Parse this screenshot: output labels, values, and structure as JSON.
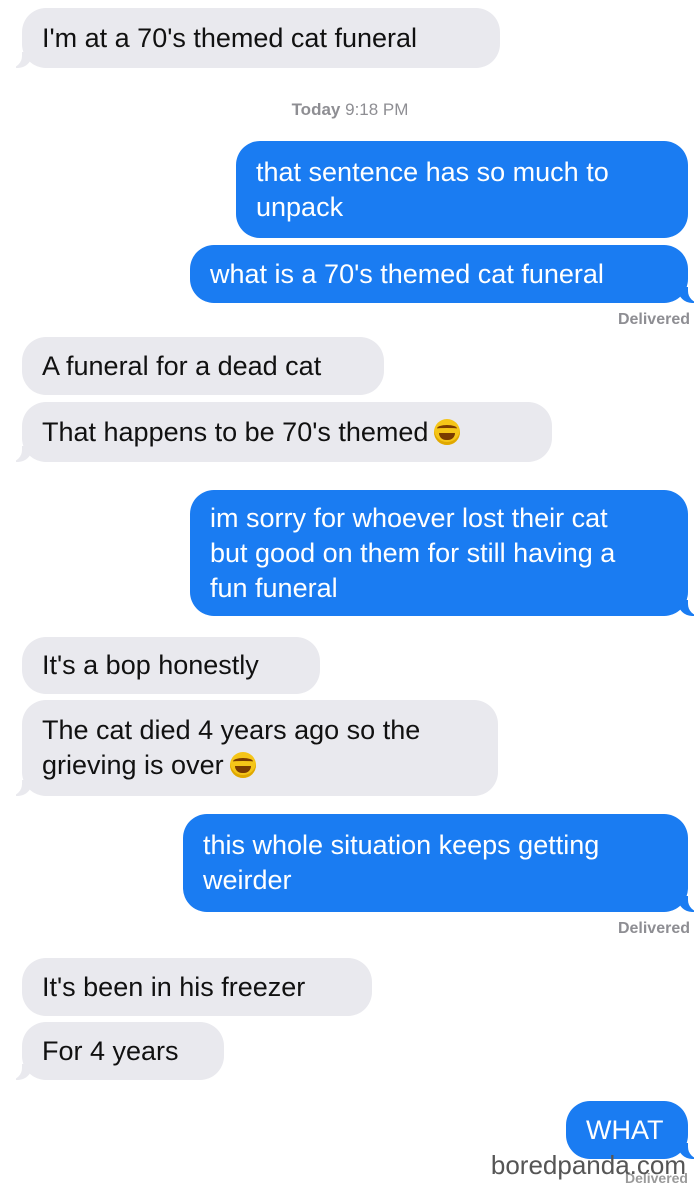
{
  "timestamp": {
    "day": "Today",
    "time": "9:18 PM"
  },
  "messages": [
    {
      "lines": [
        "I'm at a 70's themed cat funeral"
      ]
    },
    {
      "lines": [
        "that sentence has so much to",
        "unpack"
      ]
    },
    {
      "lines": [
        "what is a 70's themed cat funeral"
      ]
    },
    {
      "lines": [
        "A funeral for a dead cat"
      ]
    },
    {
      "lines": [
        "That happens to be 70's themed"
      ],
      "emoji": "laughing-tears-emoji"
    },
    {
      "lines": [
        "im sorry for whoever lost their cat",
        "but good on them for still having a",
        "fun funeral"
      ]
    },
    {
      "lines": [
        "It's a bop honestly"
      ]
    },
    {
      "lines": [
        "The cat died 4 years ago so the",
        "grieving is over"
      ],
      "emoji": "laughing-tears-emoji"
    },
    {
      "lines": [
        "this whole situation keeps getting",
        "weirder"
      ]
    },
    {
      "lines": [
        "It's been in his freezer"
      ]
    },
    {
      "lines": [
        "For 4 years"
      ]
    },
    {
      "lines": [
        "WHAT"
      ]
    }
  ],
  "delivered_labels": [
    "Delivered",
    "Delivered",
    "Delivered"
  ],
  "watermark": "boredpanda.com",
  "colors": {
    "incoming_bubble": "#e9e9ee",
    "outgoing_bubble": "#1a7cf2",
    "meta_text": "#8e8e93"
  }
}
